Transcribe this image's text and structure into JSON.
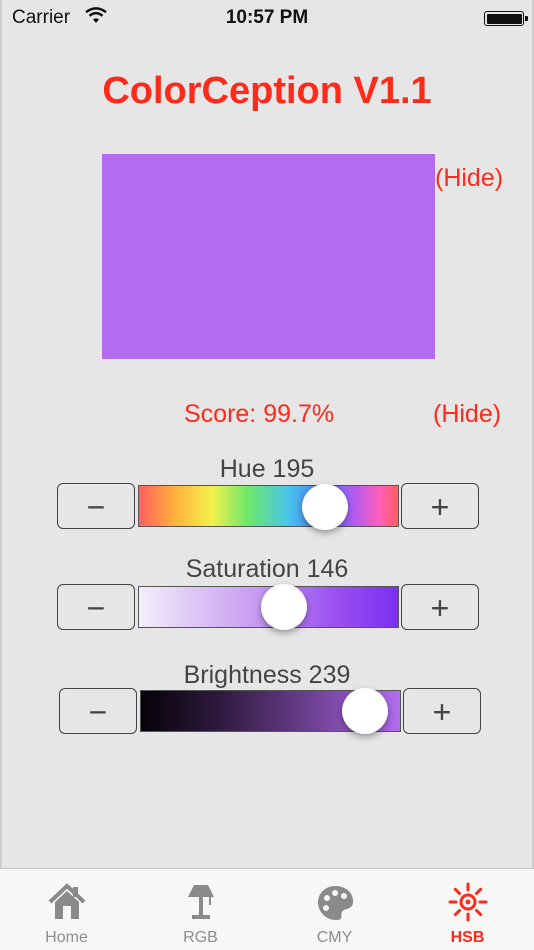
{
  "status": {
    "carrier": "Carrier",
    "time": "10:57 PM"
  },
  "app": {
    "title": "ColorCeption V1.1"
  },
  "swatch": {
    "color": "#b36cef",
    "hide_label": "(Hide)"
  },
  "score": {
    "text": "Score: 99.7%",
    "hide_label": "(Hide)"
  },
  "sliders": [
    {
      "label": "Hue  195",
      "value": 195,
      "max": 255,
      "minus": "−",
      "plus": "+"
    },
    {
      "label": "Saturation  146",
      "value": 146,
      "max": 255,
      "minus": "−",
      "plus": "+"
    },
    {
      "label": "Brightness  239",
      "value": 239,
      "max": 255,
      "minus": "−",
      "plus": "+"
    }
  ],
  "colors": {
    "accent": "#fe2b1b",
    "inactive": "#8e8e8e",
    "tab_icon": "#8a8a8a"
  },
  "tabs": [
    {
      "label": "Home",
      "icon": "home-icon",
      "active": false
    },
    {
      "label": "RGB",
      "icon": "lamp-icon",
      "active": false
    },
    {
      "label": "CMY",
      "icon": "palette-icon",
      "active": false
    },
    {
      "label": "HSB",
      "icon": "sun-icon",
      "active": true
    }
  ]
}
